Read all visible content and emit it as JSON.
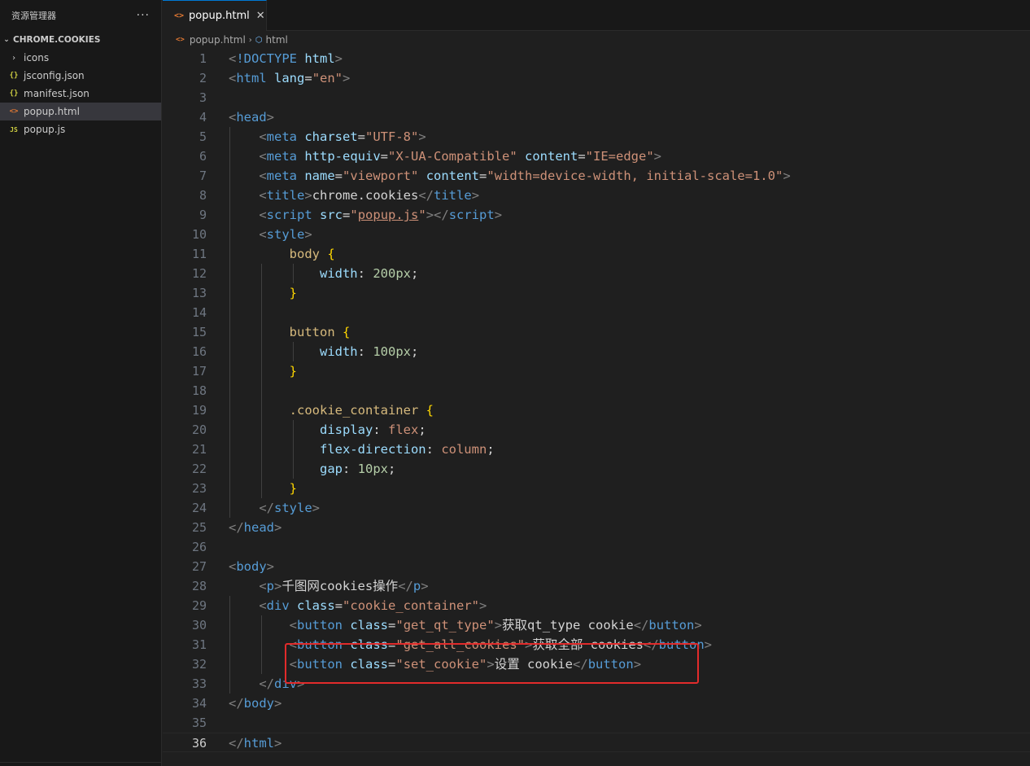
{
  "explorer": {
    "title": "资源管理器",
    "more": "···",
    "folder": "CHROME.COOKIES",
    "items": [
      {
        "icon": "chevron-right-icon",
        "glyph": "›",
        "label": "icons"
      },
      {
        "icon": "json-file-icon",
        "glyph": "{}",
        "label": "jsconfig.json"
      },
      {
        "icon": "json-file-icon",
        "glyph": "{}",
        "label": "manifest.json"
      },
      {
        "icon": "html-file-icon",
        "glyph": "<>",
        "label": "popup.html",
        "active": true
      },
      {
        "icon": "js-file-icon",
        "glyph": "JS",
        "label": "popup.js"
      }
    ]
  },
  "tab": {
    "label": "popup.html",
    "icon": "<>",
    "close": "✕"
  },
  "breadcrumb": {
    "file": "popup.html",
    "sep": "›",
    "symbol": "html"
  },
  "editor": {
    "current_line": 36,
    "line_numbers": [
      "1",
      "2",
      "3",
      "4",
      "5",
      "6",
      "7",
      "8",
      "9",
      "10",
      "11",
      "12",
      "13",
      "14",
      "15",
      "16",
      "17",
      "18",
      "19",
      "20",
      "21",
      "22",
      "23",
      "24",
      "25",
      "26",
      "27",
      "28",
      "29",
      "30",
      "31",
      "32",
      "33",
      "34",
      "35",
      "36"
    ],
    "lines": [
      [
        [
          "br",
          "<"
        ],
        [
          "tag",
          "!DOCTYPE"
        ],
        [
          "txt",
          " "
        ],
        [
          "attr",
          "html"
        ],
        [
          "br",
          ">"
        ]
      ],
      [
        [
          "br",
          "<"
        ],
        [
          "tag",
          "html"
        ],
        [
          "txt",
          " "
        ],
        [
          "attr",
          "lang"
        ],
        [
          "punc",
          "="
        ],
        [
          "str",
          "\"en\""
        ],
        [
          "br",
          ">"
        ]
      ],
      [],
      [
        [
          "br",
          "<"
        ],
        [
          "tag",
          "head"
        ],
        [
          "br",
          ">"
        ]
      ],
      [
        [
          "txt",
          "    "
        ],
        [
          "br",
          "<"
        ],
        [
          "tag",
          "meta"
        ],
        [
          "txt",
          " "
        ],
        [
          "attr",
          "charset"
        ],
        [
          "punc",
          "="
        ],
        [
          "str",
          "\"UTF-8\""
        ],
        [
          "br",
          ">"
        ]
      ],
      [
        [
          "txt",
          "    "
        ],
        [
          "br",
          "<"
        ],
        [
          "tag",
          "meta"
        ],
        [
          "txt",
          " "
        ],
        [
          "attr",
          "http-equiv"
        ],
        [
          "punc",
          "="
        ],
        [
          "str",
          "\"X-UA-Compatible\""
        ],
        [
          "txt",
          " "
        ],
        [
          "attr",
          "content"
        ],
        [
          "punc",
          "="
        ],
        [
          "str",
          "\"IE=edge\""
        ],
        [
          "br",
          ">"
        ]
      ],
      [
        [
          "txt",
          "    "
        ],
        [
          "br",
          "<"
        ],
        [
          "tag",
          "meta"
        ],
        [
          "txt",
          " "
        ],
        [
          "attr",
          "name"
        ],
        [
          "punc",
          "="
        ],
        [
          "str",
          "\"viewport\""
        ],
        [
          "txt",
          " "
        ],
        [
          "attr",
          "content"
        ],
        [
          "punc",
          "="
        ],
        [
          "str",
          "\"width=device-width, initial-scale=1.0\""
        ],
        [
          "br",
          ">"
        ]
      ],
      [
        [
          "txt",
          "    "
        ],
        [
          "br",
          "<"
        ],
        [
          "tag",
          "title"
        ],
        [
          "br",
          ">"
        ],
        [
          "txt",
          "chrome.cookies"
        ],
        [
          "br",
          "</"
        ],
        [
          "tag",
          "title"
        ],
        [
          "br",
          ">"
        ]
      ],
      [
        [
          "txt",
          "    "
        ],
        [
          "br",
          "<"
        ],
        [
          "tag",
          "script"
        ],
        [
          "txt",
          " "
        ],
        [
          "attr",
          "src"
        ],
        [
          "punc",
          "="
        ],
        [
          "str",
          "\""
        ],
        [
          "link",
          "popup.js"
        ],
        [
          "str",
          "\""
        ],
        [
          "br",
          "></"
        ],
        [
          "tag",
          "script"
        ],
        [
          "br",
          ">"
        ]
      ],
      [
        [
          "txt",
          "    "
        ],
        [
          "br",
          "<"
        ],
        [
          "tag",
          "style"
        ],
        [
          "br",
          ">"
        ]
      ],
      [
        [
          "txt",
          "        "
        ],
        [
          "sel",
          "body"
        ],
        [
          "txt",
          " "
        ],
        [
          "brace",
          "{"
        ]
      ],
      [
        [
          "txt",
          "            "
        ],
        [
          "prop",
          "width"
        ],
        [
          "punc",
          ": "
        ],
        [
          "num",
          "200px"
        ],
        [
          "punc",
          ";"
        ]
      ],
      [
        [
          "txt",
          "        "
        ],
        [
          "brace",
          "}"
        ]
      ],
      [],
      [
        [
          "txt",
          "        "
        ],
        [
          "sel",
          "button"
        ],
        [
          "txt",
          " "
        ],
        [
          "brace",
          "{"
        ]
      ],
      [
        [
          "txt",
          "            "
        ],
        [
          "prop",
          "width"
        ],
        [
          "punc",
          ": "
        ],
        [
          "num",
          "100px"
        ],
        [
          "punc",
          ";"
        ]
      ],
      [
        [
          "txt",
          "        "
        ],
        [
          "brace",
          "}"
        ]
      ],
      [],
      [
        [
          "txt",
          "        "
        ],
        [
          "sel",
          ".cookie_container"
        ],
        [
          "txt",
          " "
        ],
        [
          "brace",
          "{"
        ]
      ],
      [
        [
          "txt",
          "            "
        ],
        [
          "prop",
          "display"
        ],
        [
          "punc",
          ": "
        ],
        [
          "val",
          "flex"
        ],
        [
          "punc",
          ";"
        ]
      ],
      [
        [
          "txt",
          "            "
        ],
        [
          "prop",
          "flex-direction"
        ],
        [
          "punc",
          ": "
        ],
        [
          "val",
          "column"
        ],
        [
          "punc",
          ";"
        ]
      ],
      [
        [
          "txt",
          "            "
        ],
        [
          "prop",
          "gap"
        ],
        [
          "punc",
          ": "
        ],
        [
          "num",
          "10px"
        ],
        [
          "punc",
          ";"
        ]
      ],
      [
        [
          "txt",
          "        "
        ],
        [
          "brace",
          "}"
        ]
      ],
      [
        [
          "txt",
          "    "
        ],
        [
          "br",
          "</"
        ],
        [
          "tag",
          "style"
        ],
        [
          "br",
          ">"
        ]
      ],
      [
        [
          "br",
          "</"
        ],
        [
          "tag",
          "head"
        ],
        [
          "br",
          ">"
        ]
      ],
      [],
      [
        [
          "br",
          "<"
        ],
        [
          "tag",
          "body"
        ],
        [
          "br",
          ">"
        ]
      ],
      [
        [
          "txt",
          "    "
        ],
        [
          "br",
          "<"
        ],
        [
          "tag",
          "p"
        ],
        [
          "br",
          ">"
        ],
        [
          "txt",
          "千图网cookies操作"
        ],
        [
          "br",
          "</"
        ],
        [
          "tag",
          "p"
        ],
        [
          "br",
          ">"
        ]
      ],
      [
        [
          "txt",
          "    "
        ],
        [
          "br",
          "<"
        ],
        [
          "tag",
          "div"
        ],
        [
          "txt",
          " "
        ],
        [
          "attr",
          "class"
        ],
        [
          "punc",
          "="
        ],
        [
          "str",
          "\"cookie_container\""
        ],
        [
          "br",
          ">"
        ]
      ],
      [
        [
          "txt",
          "        "
        ],
        [
          "br",
          "<"
        ],
        [
          "tag",
          "button"
        ],
        [
          "txt",
          " "
        ],
        [
          "attr",
          "class"
        ],
        [
          "punc",
          "="
        ],
        [
          "str",
          "\"get_qt_type\""
        ],
        [
          "br",
          ">"
        ],
        [
          "txt",
          "获取qt_type cookie"
        ],
        [
          "br",
          "</"
        ],
        [
          "tag",
          "button"
        ],
        [
          "br",
          ">"
        ]
      ],
      [
        [
          "txt",
          "        "
        ],
        [
          "br",
          "<"
        ],
        [
          "tag",
          "button"
        ],
        [
          "txt",
          " "
        ],
        [
          "attr",
          "class"
        ],
        [
          "punc",
          "="
        ],
        [
          "str",
          "\"get_all_cookies\""
        ],
        [
          "br",
          ">"
        ],
        [
          "txt",
          "获取全部 cookies"
        ],
        [
          "br",
          "</"
        ],
        [
          "tag",
          "button"
        ],
        [
          "br",
          ">"
        ]
      ],
      [
        [
          "txt",
          "        "
        ],
        [
          "br",
          "<"
        ],
        [
          "tag",
          "button"
        ],
        [
          "txt",
          " "
        ],
        [
          "attr",
          "class"
        ],
        [
          "punc",
          "="
        ],
        [
          "str",
          "\"set_cookie\""
        ],
        [
          "br",
          ">"
        ],
        [
          "txt",
          "设置 cookie"
        ],
        [
          "br",
          "</"
        ],
        [
          "tag",
          "button"
        ],
        [
          "br",
          ">"
        ]
      ],
      [
        [
          "txt",
          "    "
        ],
        [
          "br",
          "</"
        ],
        [
          "tag",
          "div"
        ],
        [
          "br",
          ">"
        ]
      ],
      [
        [
          "br",
          "</"
        ],
        [
          "tag",
          "body"
        ],
        [
          "br",
          ">"
        ]
      ],
      [],
      [
        [
          "br",
          "</"
        ],
        [
          "tag",
          "html"
        ],
        [
          "br",
          ">"
        ]
      ]
    ]
  }
}
